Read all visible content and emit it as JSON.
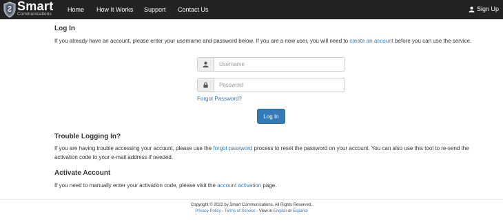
{
  "brand": {
    "name": "Smart",
    "tagline": "Communications"
  },
  "nav": {
    "items": [
      {
        "label": "Home"
      },
      {
        "label": "How It Works"
      },
      {
        "label": "Support"
      },
      {
        "label": "Contact Us"
      }
    ],
    "signup": "Sign Up"
  },
  "login": {
    "title": "Log In",
    "intro_before": "If you already have an account, please enter your username and password below. If you are a new user, you will need to ",
    "intro_link": "create an account",
    "intro_after": " before you can use the service.",
    "username_placeholder": "Username",
    "password_placeholder": "Password",
    "forgot": "Forgot Password?",
    "submit": "Log In"
  },
  "trouble": {
    "title": "Trouble Logging In?",
    "text_before": "If you are having trouble accessing your account, please use the ",
    "link": "forgot password",
    "text_after": " process to reset the password on your account. You can also use this tool to re-send the activation code to your e-mail address if needed."
  },
  "activate": {
    "title": "Activate Account",
    "text_before": "If you need to manually enter your activation code, please visit the ",
    "link": "account activation",
    "text_after": " page."
  },
  "footer": {
    "copyright": "Copyright © 2022 by Smart Communications. All Rights Reserved.",
    "privacy": "Privacy Policy",
    "sep1": " - ",
    "terms": "Terms of Service",
    "view_in": " - View in ",
    "english": "English",
    "or": " or ",
    "spanish": "Español"
  },
  "colors": {
    "navbar": "#222222",
    "link": "#337ab7",
    "button": "#337ab7"
  },
  "icons": {
    "username": "user-icon",
    "password": "lock-icon",
    "signup": "user-icon"
  }
}
